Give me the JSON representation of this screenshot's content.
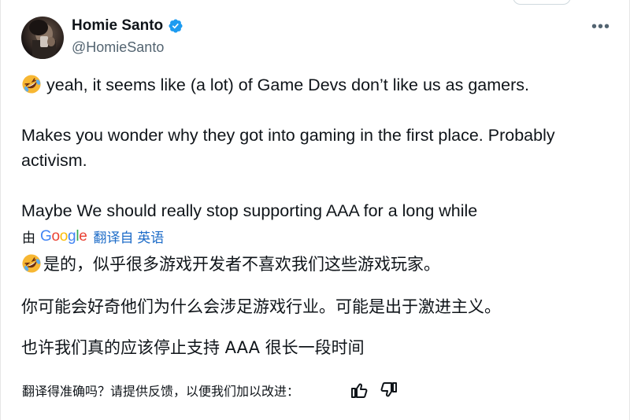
{
  "author": {
    "display_name": "Homie Santo",
    "handle": "@HomieSanto",
    "verified": true,
    "verified_color": "#1d9bf0"
  },
  "more_menu_label": "•••",
  "original_text": {
    "line1": "yeah, it seems like (a lot) of Game Devs don’t like us as gamers.",
    "line2": "Makes you wonder why they got into gaming in the first place. Probably",
    "line3": "activism.",
    "line4": "Maybe We should really stop supporting AAA for a long while",
    "emoji": "rolling-on-floor-laughing-emoji"
  },
  "translation": {
    "by_label": "由",
    "provider": "Google",
    "link_label": "翻译自 英语",
    "line1": "是的，似乎很多游戏开发者不喜欢我们这些游戏玩家。",
    "line2": "你可能会好奇他们为什么会涉足游戏行业。可能是出于激进主义。",
    "line3": "也许我们真的应该停止支持 AAA 很长一段时间"
  },
  "feedback": {
    "prompt": "翻译得准确吗？请提供反馈，以便我们加以改进：",
    "thumbs_up_icon": "thumbs-up-icon",
    "thumbs_down_icon": "thumbs-down-icon"
  },
  "colors": {
    "text": "#0f1419",
    "secondary": "#536471",
    "link": "#1d6cc8",
    "google_blue": "#4285f4",
    "google_red": "#ea4335",
    "google_yellow": "#fbbc05",
    "google_green": "#34a853"
  }
}
